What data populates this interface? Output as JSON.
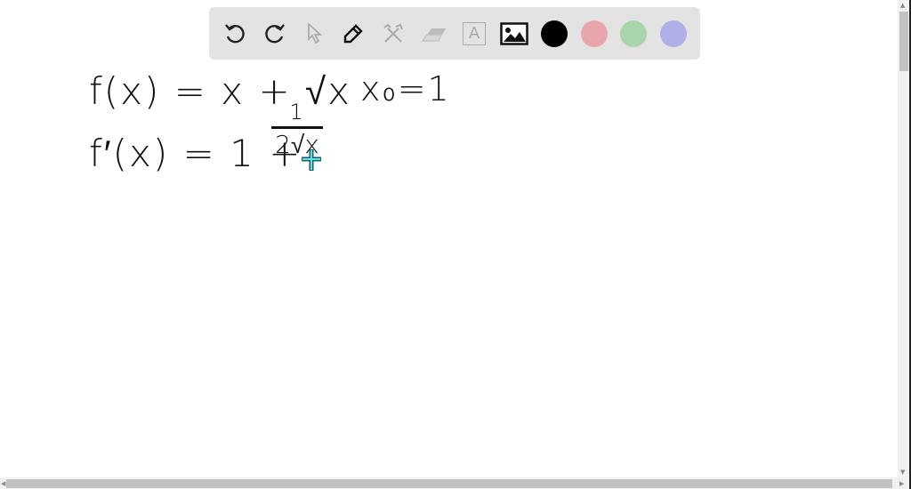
{
  "toolbar": {
    "tools": [
      "undo-icon",
      "redo-icon",
      "select-icon",
      "pen-icon",
      "tools-icon",
      "eraser-icon",
      "text-icon",
      "image-icon"
    ],
    "text_tool_glyph": "A",
    "colors": [
      "#000000",
      "#e8a5ab",
      "#a8d5aa",
      "#b0b0e8"
    ]
  },
  "canvas": {
    "line1": "f(x) = x + √x",
    "x0": "x₀=1",
    "line2_left": "f′(x) = 1 +",
    "frac_num": "1",
    "frac_den": "2√x"
  },
  "cursor": {
    "color": "#2aa7b5"
  }
}
